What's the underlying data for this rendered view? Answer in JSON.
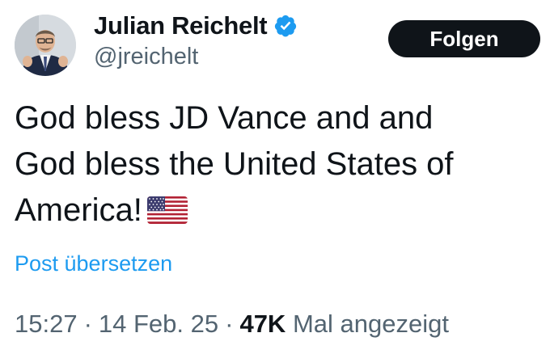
{
  "author": {
    "display_name": "Julian Reichelt",
    "handle": "@jreichelt",
    "verified": true,
    "avatar_icon": "profile-photo"
  },
  "follow_button": {
    "label": "Folgen"
  },
  "tweet": {
    "lines": [
      "God bless JD Vance and and",
      "God bless the United States of",
      "America!"
    ],
    "emoji": "us-flag-icon"
  },
  "translate": {
    "label": "Post übersetzen"
  },
  "meta": {
    "time": "15:27",
    "separator": "·",
    "date": "14 Feb. 25",
    "views_count": "47K",
    "views_label": "Mal angezeigt"
  },
  "colors": {
    "text": "#0f1419",
    "secondary": "#536471",
    "link": "#1d9bf0",
    "button_bg": "#0f1419",
    "verified": "#1d9bf0"
  }
}
